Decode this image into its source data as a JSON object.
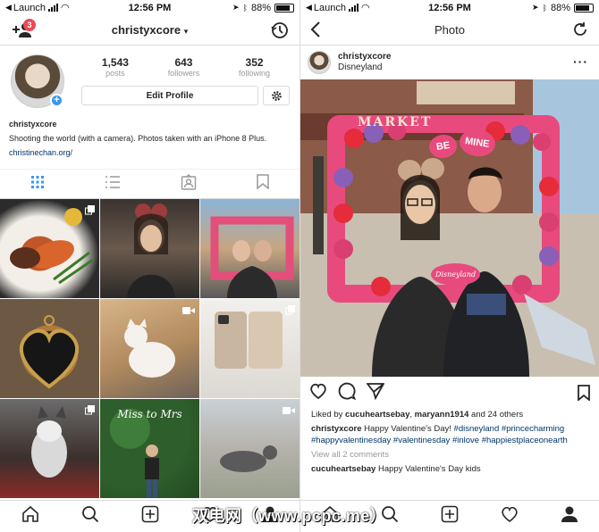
{
  "status": {
    "carrier": "Launch",
    "time": "12:56 PM",
    "battery": "88%"
  },
  "profile": {
    "username": "christyxcore",
    "notif_count": "3",
    "stats": [
      {
        "value": "1,543",
        "label": "posts"
      },
      {
        "value": "643",
        "label": "followers"
      },
      {
        "value": "352",
        "label": "following"
      }
    ],
    "edit_label": "Edit Profile",
    "bio_name": "christyxcore",
    "bio_text": "Shooting the world (with a camera). Photos taken with an iPhone 8 Plus.",
    "bio_link": "christinechan.org/"
  },
  "photo_page": {
    "title": "Photo",
    "username": "christyxcore",
    "location": "Disneyland",
    "sign_market": "MARKET",
    "heart_be": "BE",
    "heart_mine": "MINE",
    "frame_brand": "Disneyland",
    "liked_by": "Liked by",
    "liker1": "cucuheartsebay",
    "sep1": ", ",
    "liker2": "maryann1914",
    "liked_rest": " and 24 others",
    "cap_user": "christyxcore",
    "cap_text": " Happy Valentine's Day! ",
    "tags": [
      "#disneyland",
      "#princecharming",
      "#happyvalentinesday",
      "#valentinesday",
      "#inlove",
      "#happiestplaceonearth"
    ],
    "view_comments": "View all 2 comments",
    "comment_user": "cucuheartsebay",
    "comment_text": " Happy Valentine's Day kids"
  },
  "grid_thumbs": {
    "thumb8_text": "Miss to Mrs"
  },
  "watermark": "双电网（www.pcpc.me）",
  "colors": {
    "accent": "#3897f0",
    "badge": "#ed4956",
    "link": "#003569"
  }
}
